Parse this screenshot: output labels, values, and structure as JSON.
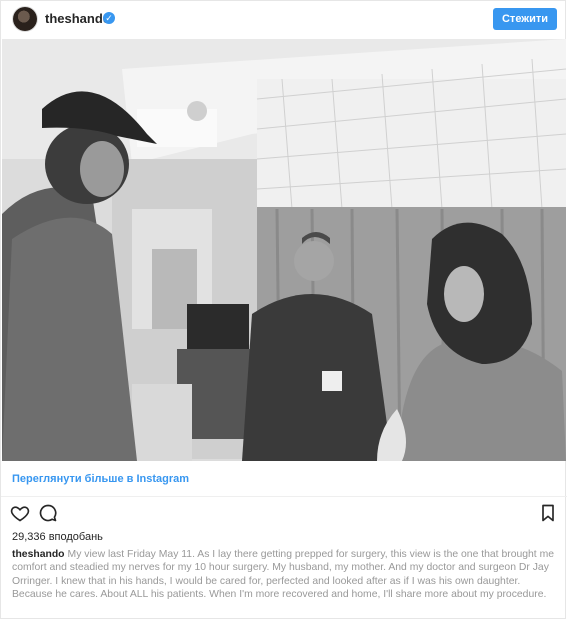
{
  "header": {
    "username": "theshando",
    "verified_glyph": "✓",
    "follow_label": "Стежити"
  },
  "photo": {
    "description_icon": "photo-image"
  },
  "view_more": {
    "label": "Переглянути більше в Instagram"
  },
  "actions": {
    "like_icon": "heart-icon",
    "comment_icon": "comment-icon",
    "save_icon": "bookmark-icon"
  },
  "likes": {
    "text": "29,336 вподобань"
  },
  "caption": {
    "author": "theshando",
    "text": "My view last Friday May 11. As I lay there getting prepped for surgery, this view is the one that brought me comfort and steadied my nerves for my 10 hour surgery. My husband, my mother. And my doctor and surgeon Dr Jay Orringer. I knew that in his hands, I would be cared for, perfected and looked after as if I was his own daughter. Because he cares. About ALL his patients. When I'm more recovered and home, I'll share more about my procedure."
  },
  "colors": {
    "accent": "#3897f0",
    "text": "#262626",
    "muted": "#999999"
  }
}
